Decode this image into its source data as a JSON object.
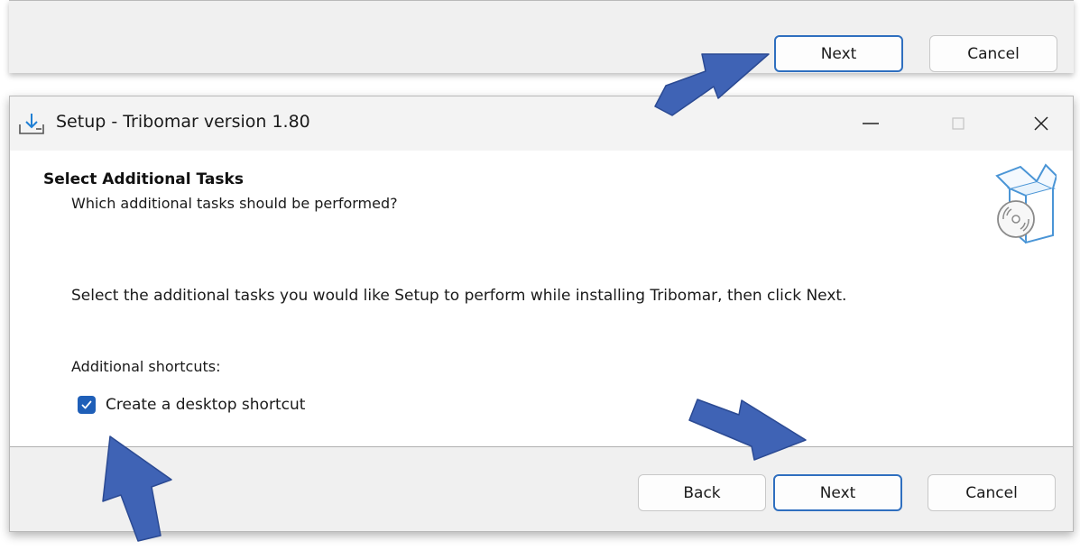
{
  "top_strip": {
    "next_label": "Next",
    "cancel_label": "Cancel"
  },
  "window": {
    "title": "Setup - Tribomar version 1.80",
    "minimize_icon": "minimize-icon",
    "maximize_icon": "maximize-icon",
    "close_icon": "close-icon"
  },
  "page": {
    "heading": "Select Additional Tasks",
    "subheading": "Which additional tasks should be performed?",
    "instructions": "Select the additional tasks you would like Setup to perform while installing Tribomar, then click Next.",
    "group_label": "Additional shortcuts:",
    "task": {
      "label": "Create a desktop shortcut",
      "checked": true
    }
  },
  "footer": {
    "back_label": "Back",
    "next_label": "Next",
    "cancel_label": "Cancel"
  },
  "colors": {
    "accent": "#2f6fbf",
    "checkbox": "#1f5fb8",
    "annotation_arrow": "#3f63b5"
  }
}
